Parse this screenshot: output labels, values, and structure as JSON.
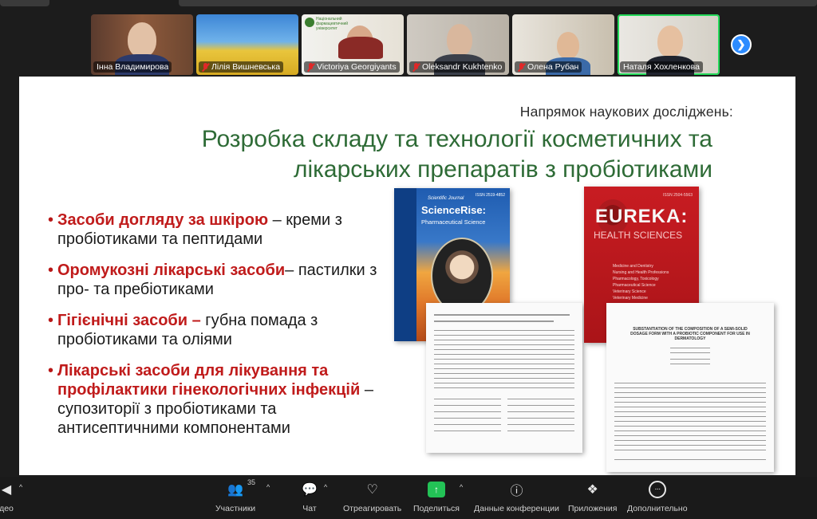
{
  "participants": [
    {
      "name": "Інна Владимирова",
      "muted": false
    },
    {
      "name": "Лілія Вишневська",
      "muted": true
    },
    {
      "name": "Victoriya Georgiyants",
      "muted": true
    },
    {
      "name": "Oleksandr Kukhtenko",
      "muted": true
    },
    {
      "name": "Олена Рубан",
      "muted": true
    },
    {
      "name": "Наталя Хохленкова",
      "muted": false
    }
  ],
  "tile_logo_text": "Національний фармацевтичний університет",
  "next_page_icon": "chevron-right-icon",
  "slide": {
    "subtitle": "Напрямок наукових досліджень:",
    "title_line1": "Розробка складу та технології косметичних та",
    "title_line2": "лікарських препаратів з пробіотиками",
    "bullets": [
      {
        "red": "Засоби догляду за шкірою",
        "rest": " – креми з пробіотиками та пептидами"
      },
      {
        "red": "Оромукозні лікарські засоби",
        "rest": "– пастилки з про- та пребіотиками"
      },
      {
        "red": "Гігієнічні засоби –",
        "rest": " губна помада з пробіотиками та оліями"
      },
      {
        "red": "Лікарські засоби для лікування та профілактики гінекологічних інфекцій",
        "rest": " – супозиторії з пробіотиками та антисептичними компонентами"
      }
    ],
    "journal1": {
      "label": "Scientific Journal",
      "name": "ScienceRise:",
      "sub": "Pharmaceutical Science",
      "issn": "ISSN 2519-4852"
    },
    "journal2": {
      "name": "EUREKA:",
      "sub": "HEALTH SCIENCES",
      "issn": "ISSN 2504-5563",
      "list": [
        "Medicine and Dentistry",
        "Nursing and Health Professions",
        "Pharmacology, Toxicology",
        "Pharmaceutical Science",
        "Veterinary Science",
        "Veterinary Medicine"
      ]
    },
    "paper2_title": "SUBSTANTIATION OF THE COMPOSITION OF A SEMI-SOLID DOSAGE FORM WITH A PROBIOTIC COMPONENT FOR USE IN DERMATOLOGY"
  },
  "toolbar": {
    "left_label": "део",
    "participants_count": "35",
    "items": [
      {
        "label": "Участники",
        "icon": "participants-icon"
      },
      {
        "label": "Чат",
        "icon": "chat-icon"
      },
      {
        "label": "Отреагировать",
        "icon": "heart-icon"
      },
      {
        "label": "Поделиться",
        "icon": "share-icon"
      },
      {
        "label": "Данные конференции",
        "icon": "info-icon"
      },
      {
        "label": "Приложения",
        "icon": "apps-icon"
      },
      {
        "label": "Дополнительно",
        "icon": "more-icon"
      }
    ]
  },
  "colors": {
    "accent_green": "#23d959",
    "title_green": "#2e6b36",
    "bullet_red": "#c01b1b",
    "share_green": "#23c256",
    "zoom_blue": "#2d8cff"
  }
}
